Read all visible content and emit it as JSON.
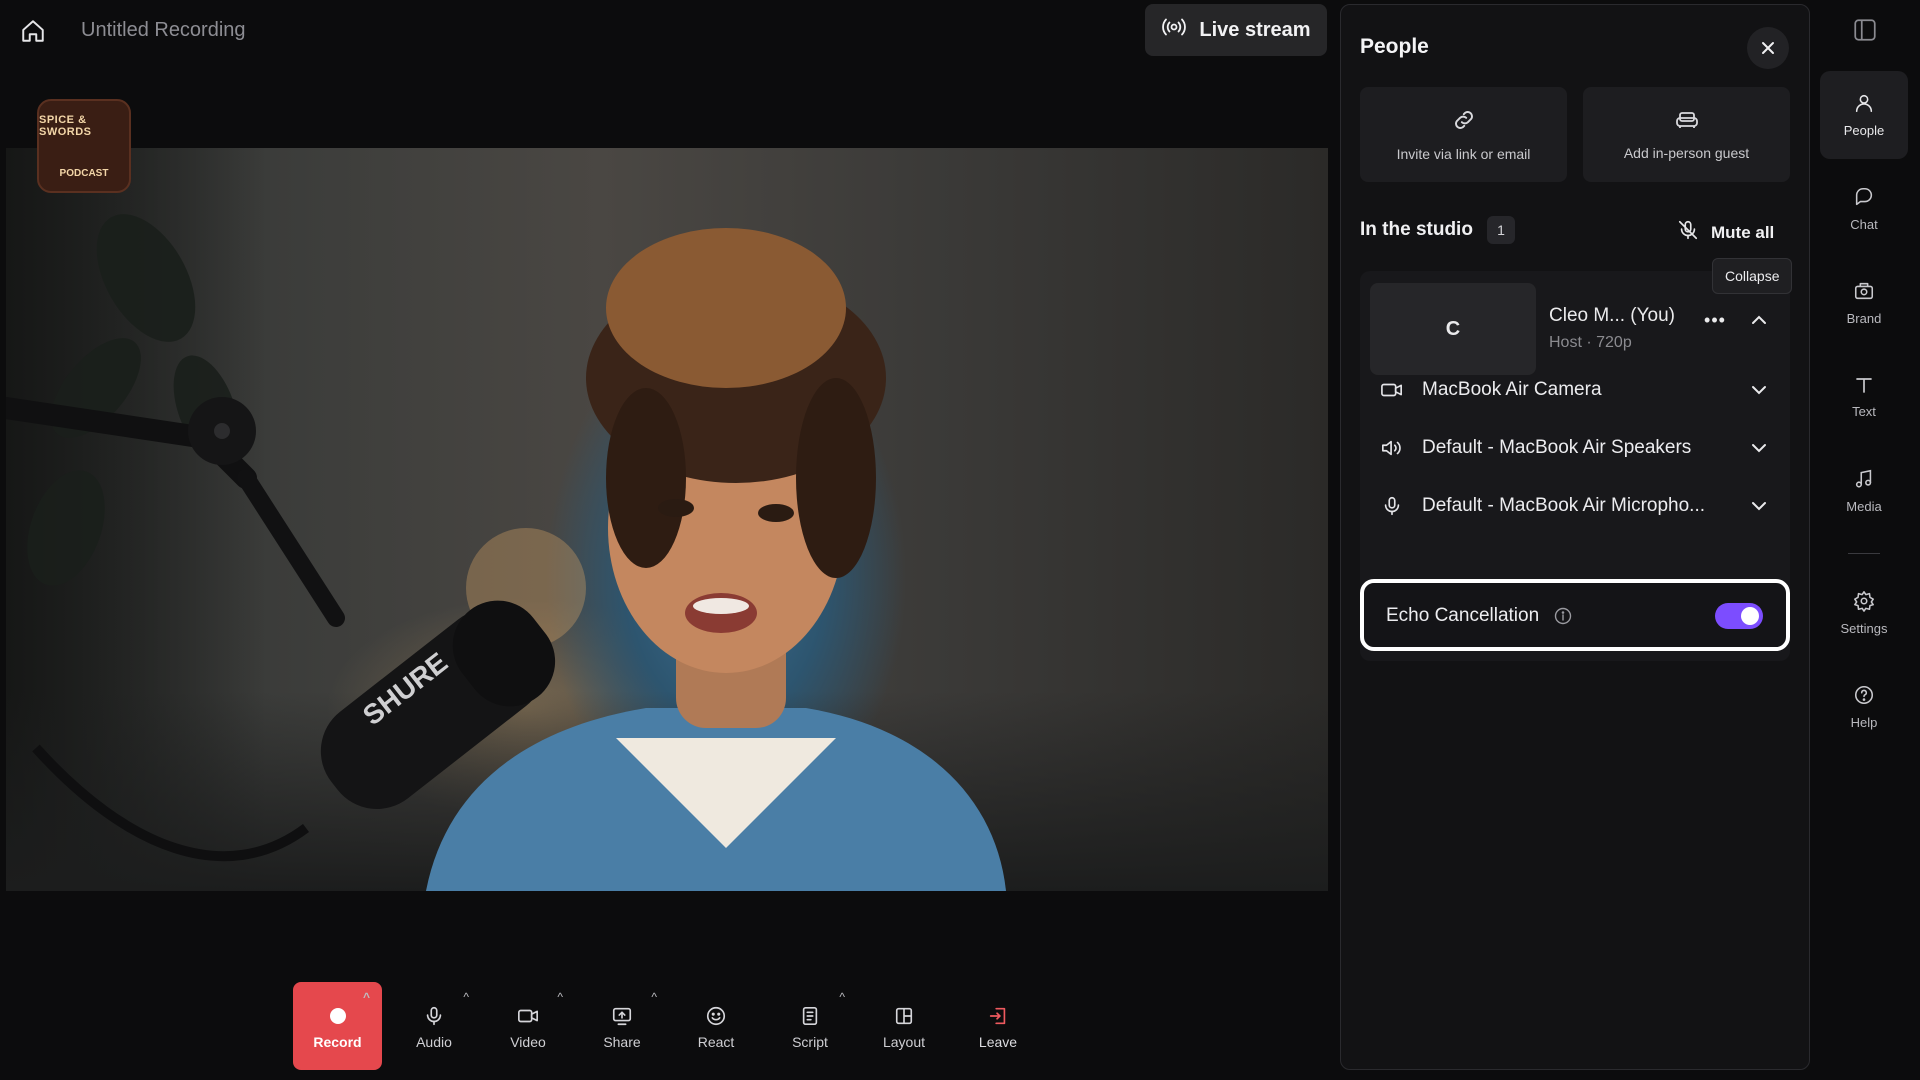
{
  "header": {
    "title": "Untitled Recording",
    "live_stream_label": "Live stream"
  },
  "stage": {
    "logo_text_top": "SPICE & SWORDS",
    "logo_text_bottom": "PODCAST",
    "mic_brand": "SHURE"
  },
  "controls": [
    {
      "label": "Record",
      "icon": "record-dot-icon"
    },
    {
      "label": "Audio",
      "icon": "microphone-icon"
    },
    {
      "label": "Video",
      "icon": "camera-icon"
    },
    {
      "label": "Share",
      "icon": "share-screen-icon"
    },
    {
      "label": "React",
      "icon": "emoji-icon"
    },
    {
      "label": "Script",
      "icon": "script-icon"
    },
    {
      "label": "Layout",
      "icon": "layout-icon"
    },
    {
      "label": "Leave",
      "icon": "leave-icon"
    }
  ],
  "people_panel": {
    "title": "People",
    "invite_label": "Invite via link or email",
    "guest_label": "Add in-person guest",
    "studio_heading": "In the studio",
    "studio_count": "1",
    "mute_all_label": "Mute all",
    "tooltip": "Collapse",
    "host": {
      "avatar_initial": "C",
      "name": "Cleo M...  (You)",
      "subtitle": "Host · 720p"
    },
    "devices": {
      "camera": "MacBook Air Camera",
      "speakers": "Default - MacBook Air Speakers",
      "microphone": "Default - MacBook Air Micropho..."
    },
    "echo_cancellation": {
      "label": "Echo Cancellation",
      "enabled": true
    }
  },
  "rail": [
    {
      "label": "People",
      "icon": "people-icon",
      "active": true
    },
    {
      "label": "Chat",
      "icon": "chat-icon"
    },
    {
      "label": "Brand",
      "icon": "brand-icon"
    },
    {
      "label": "Text",
      "icon": "text-icon"
    },
    {
      "label": "Media",
      "icon": "media-icon"
    },
    {
      "label": "Settings",
      "icon": "gear-icon"
    },
    {
      "label": "Help",
      "icon": "help-icon"
    }
  ],
  "colors": {
    "accent": "#7c4dff",
    "record": "#e5484d",
    "background": "#0c0c0d"
  }
}
